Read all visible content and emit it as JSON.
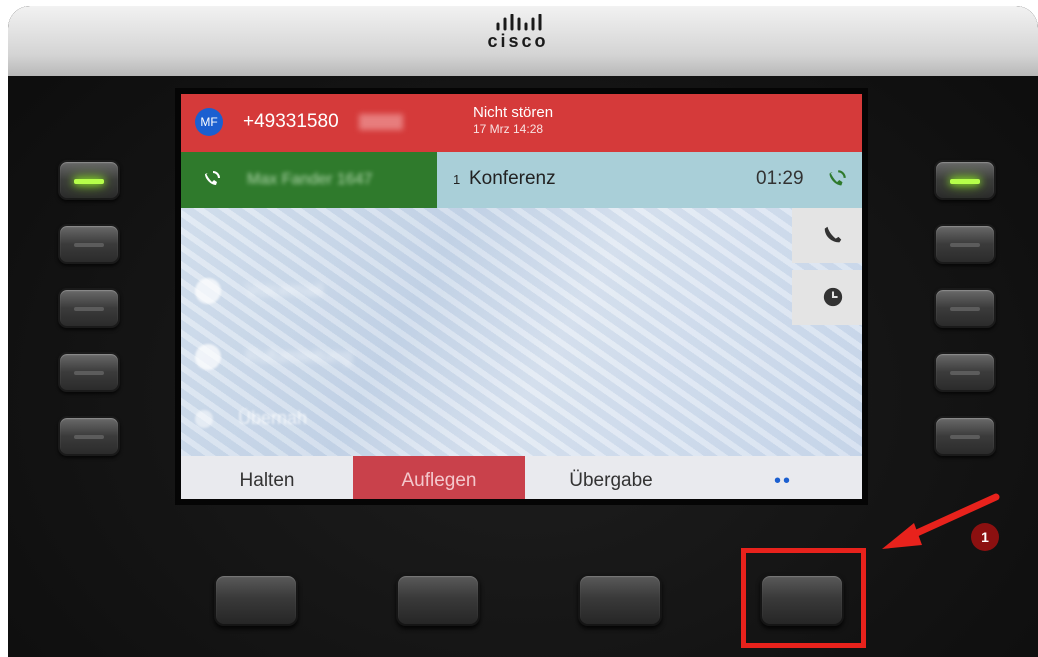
{
  "brand": {
    "logo_text": "cisco"
  },
  "status_bar": {
    "avatar_initials": "MF",
    "number": "+49331580",
    "mode": "Nicht stören",
    "datetime": "17 Mrz 14:28",
    "bg_color": "#d53a3a"
  },
  "line": {
    "caller_name": "Max Fander 1647",
    "conference_count": "1",
    "conference_label": "Konferenz",
    "timer": "01:29",
    "active_color": "#2f7a2c"
  },
  "features": {
    "item1": "Voicemail",
    "item2": "Rufumleitung",
    "item3": "Übernah"
  },
  "side_buttons": [
    {
      "icon": "phone-icon"
    },
    {
      "icon": "clock-icon"
    }
  ],
  "softkeys": {
    "hold": "Halten",
    "end_call": "Auflegen",
    "transfer": "Übergabe",
    "more": "••"
  },
  "annotation": {
    "step_number": "1",
    "color": "#e8221c"
  }
}
